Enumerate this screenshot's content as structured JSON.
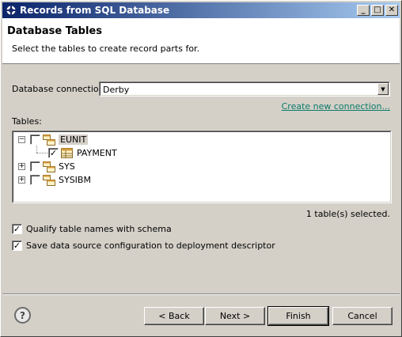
{
  "window": {
    "title": "Records from SQL Database",
    "icon": "eclipse-icon",
    "controls": {
      "minimize": "_",
      "maximize": "□",
      "close": "✕"
    }
  },
  "header": {
    "title": "Database Tables",
    "description": "Select the tables to create record parts for."
  },
  "connection": {
    "label": "Database connection:",
    "value": "Derby",
    "create_link": "Create new connection..."
  },
  "tables": {
    "label": "Tables:",
    "items": [
      {
        "name": "EUNIT",
        "checked": false,
        "expanded": true,
        "selected": true,
        "icon": "schema-icon"
      },
      {
        "name": "PAYMENT",
        "checked": true,
        "icon": "table-icon",
        "indent": 1
      },
      {
        "name": "SYS",
        "checked": false,
        "expanded": false,
        "icon": "schema-icon"
      },
      {
        "name": "SYSIBM",
        "checked": false,
        "expanded": false,
        "icon": "schema-icon"
      }
    ],
    "status": "1 table(s) selected."
  },
  "options": {
    "qualify_label": "Qualify table names with schema",
    "qualify_checked": true,
    "save_label": "Save data source configuration to deployment descriptor",
    "save_checked": true
  },
  "buttons": {
    "help": "?",
    "back": "< Back",
    "next": "Next >",
    "finish": "Finish",
    "cancel": "Cancel"
  }
}
